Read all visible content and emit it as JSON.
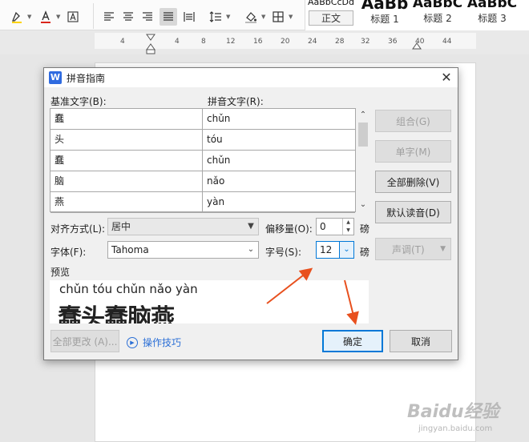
{
  "colors": {
    "accent": "#0078d7",
    "link": "#2b6fd6",
    "annotation_arrow": "#e8501e"
  },
  "ribbon": {
    "styles": [
      {
        "preview": "AaBbCcDd",
        "name": "正文"
      },
      {
        "preview": "AaBb",
        "name": "标题 1"
      },
      {
        "preview": "AaBbC",
        "name": "标题 2"
      },
      {
        "preview": "AaBbC",
        "name": "标题 3"
      }
    ],
    "icons": [
      "highlight-icon",
      "font-color-icon",
      "char-border-icon",
      "align-left-icon",
      "align-center-icon",
      "align-right-icon",
      "justify-icon",
      "distributed-icon",
      "line-spacing-icon",
      "shading-icon",
      "borders-icon"
    ]
  },
  "ruler": {
    "numbers": [
      "4",
      "4",
      "8",
      "12",
      "16",
      "20",
      "24",
      "28",
      "32",
      "36",
      "40",
      "44"
    ]
  },
  "dialog": {
    "title": "拼音指南",
    "app_icon": "W",
    "base_text_label": "基准文字(B):",
    "pinyin_text_label": "拼音文字(R):",
    "rows": [
      {
        "base": "蠢",
        "pinyin": "chǔn"
      },
      {
        "base": "头",
        "pinyin": "tóu"
      },
      {
        "base": "蠢",
        "pinyin": "chǔn"
      },
      {
        "base": "脑",
        "pinyin": "nǎo"
      },
      {
        "base": "燕",
        "pinyin": "yàn"
      }
    ],
    "buttons": {
      "combine": "组合(G)",
      "single": "单字(M)",
      "delete_all": "全部删除(V)",
      "default_reading": "默认读音(D)",
      "tone": "声调(T)",
      "apply_all": "全部更改 (A)...",
      "ok": "确定",
      "cancel": "取消"
    },
    "alignment_label": "对齐方式(L):",
    "alignment_value": "居中",
    "offset_label": "偏移量(O):",
    "offset_value": "0",
    "offset_unit": "磅",
    "font_label": "字体(F):",
    "font_value": "Tahoma",
    "size_label": "字号(S):",
    "size_value": "12",
    "size_unit": "磅",
    "preview_label": "预览",
    "preview_pinyin": "chǔn tóu chǔn nǎo yàn",
    "preview_base": "蠢头蠢脑燕",
    "tips_label": "操作技巧"
  },
  "watermark": {
    "brand": "Baidu经验",
    "url": "jingyan.baidu.com"
  }
}
